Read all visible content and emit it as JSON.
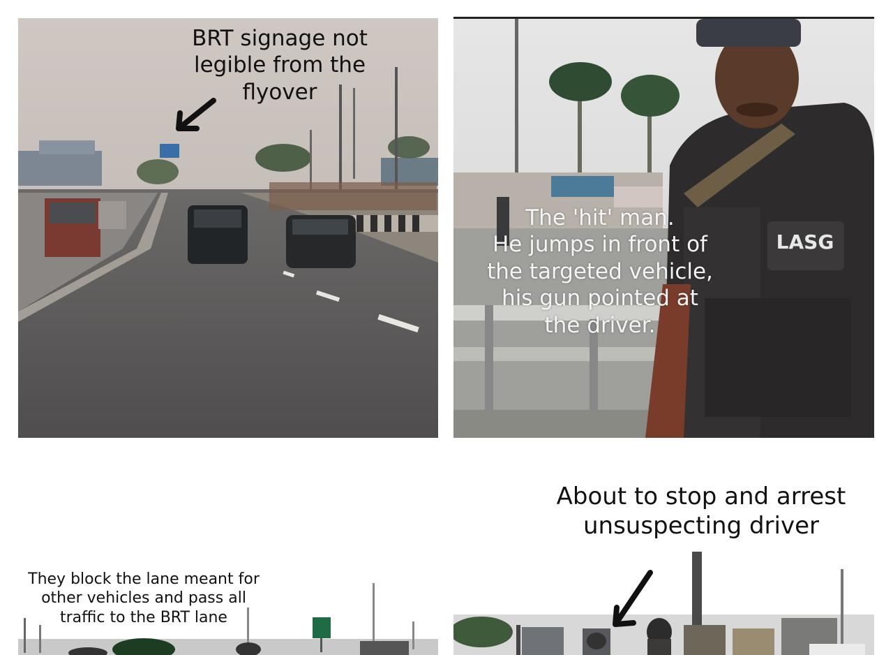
{
  "panels": [
    {
      "caption": "BRT signage not\nlegible from the\nflyover"
    },
    {
      "caption": "The 'hit' man.\nHe jumps in front of\nthe targeted vehicle,\nhis gun pointed at\nthe driver.",
      "vest_label": "LASG"
    },
    {
      "caption": "They block the lane meant for\nother vehicles and pass all\ntraffic to the BRT lane"
    },
    {
      "caption": "About to stop and arrest\nunsuspecting driver"
    }
  ],
  "icons": [
    "arrow-icon",
    "arrow-icon"
  ]
}
